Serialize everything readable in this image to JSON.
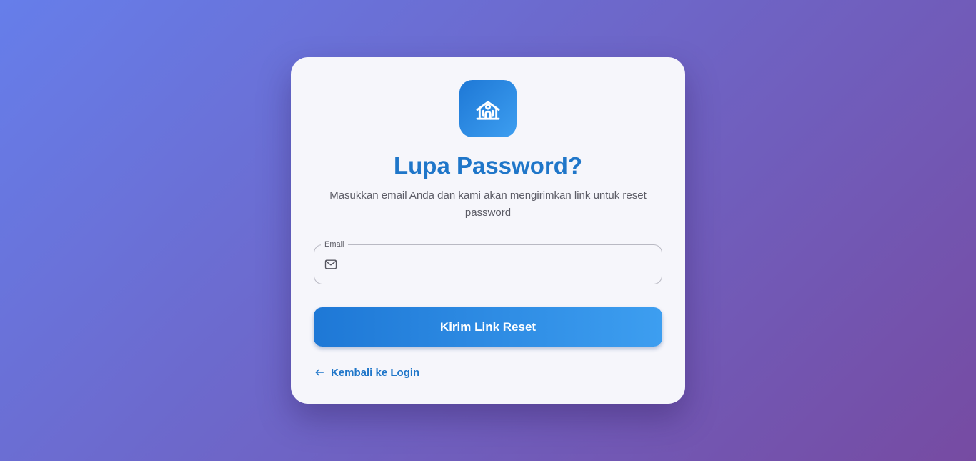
{
  "card": {
    "logo_icon": "school-building-icon",
    "title": "Lupa Password?",
    "subtitle": "Masukkan email Anda dan kami akan mengirimkan link untuk reset password"
  },
  "form": {
    "email": {
      "label": "Email",
      "value": "",
      "icon": "mail-icon"
    },
    "submit_label": "Kirim Link Reset"
  },
  "back_link": {
    "icon": "arrow-left-icon",
    "label": "Kembali ke Login"
  },
  "colors": {
    "background_start": "#667eea",
    "background_end": "#764ba2",
    "accent": "#1f76c9",
    "button_start": "#1e78d6",
    "button_end": "#3d9ef0"
  }
}
